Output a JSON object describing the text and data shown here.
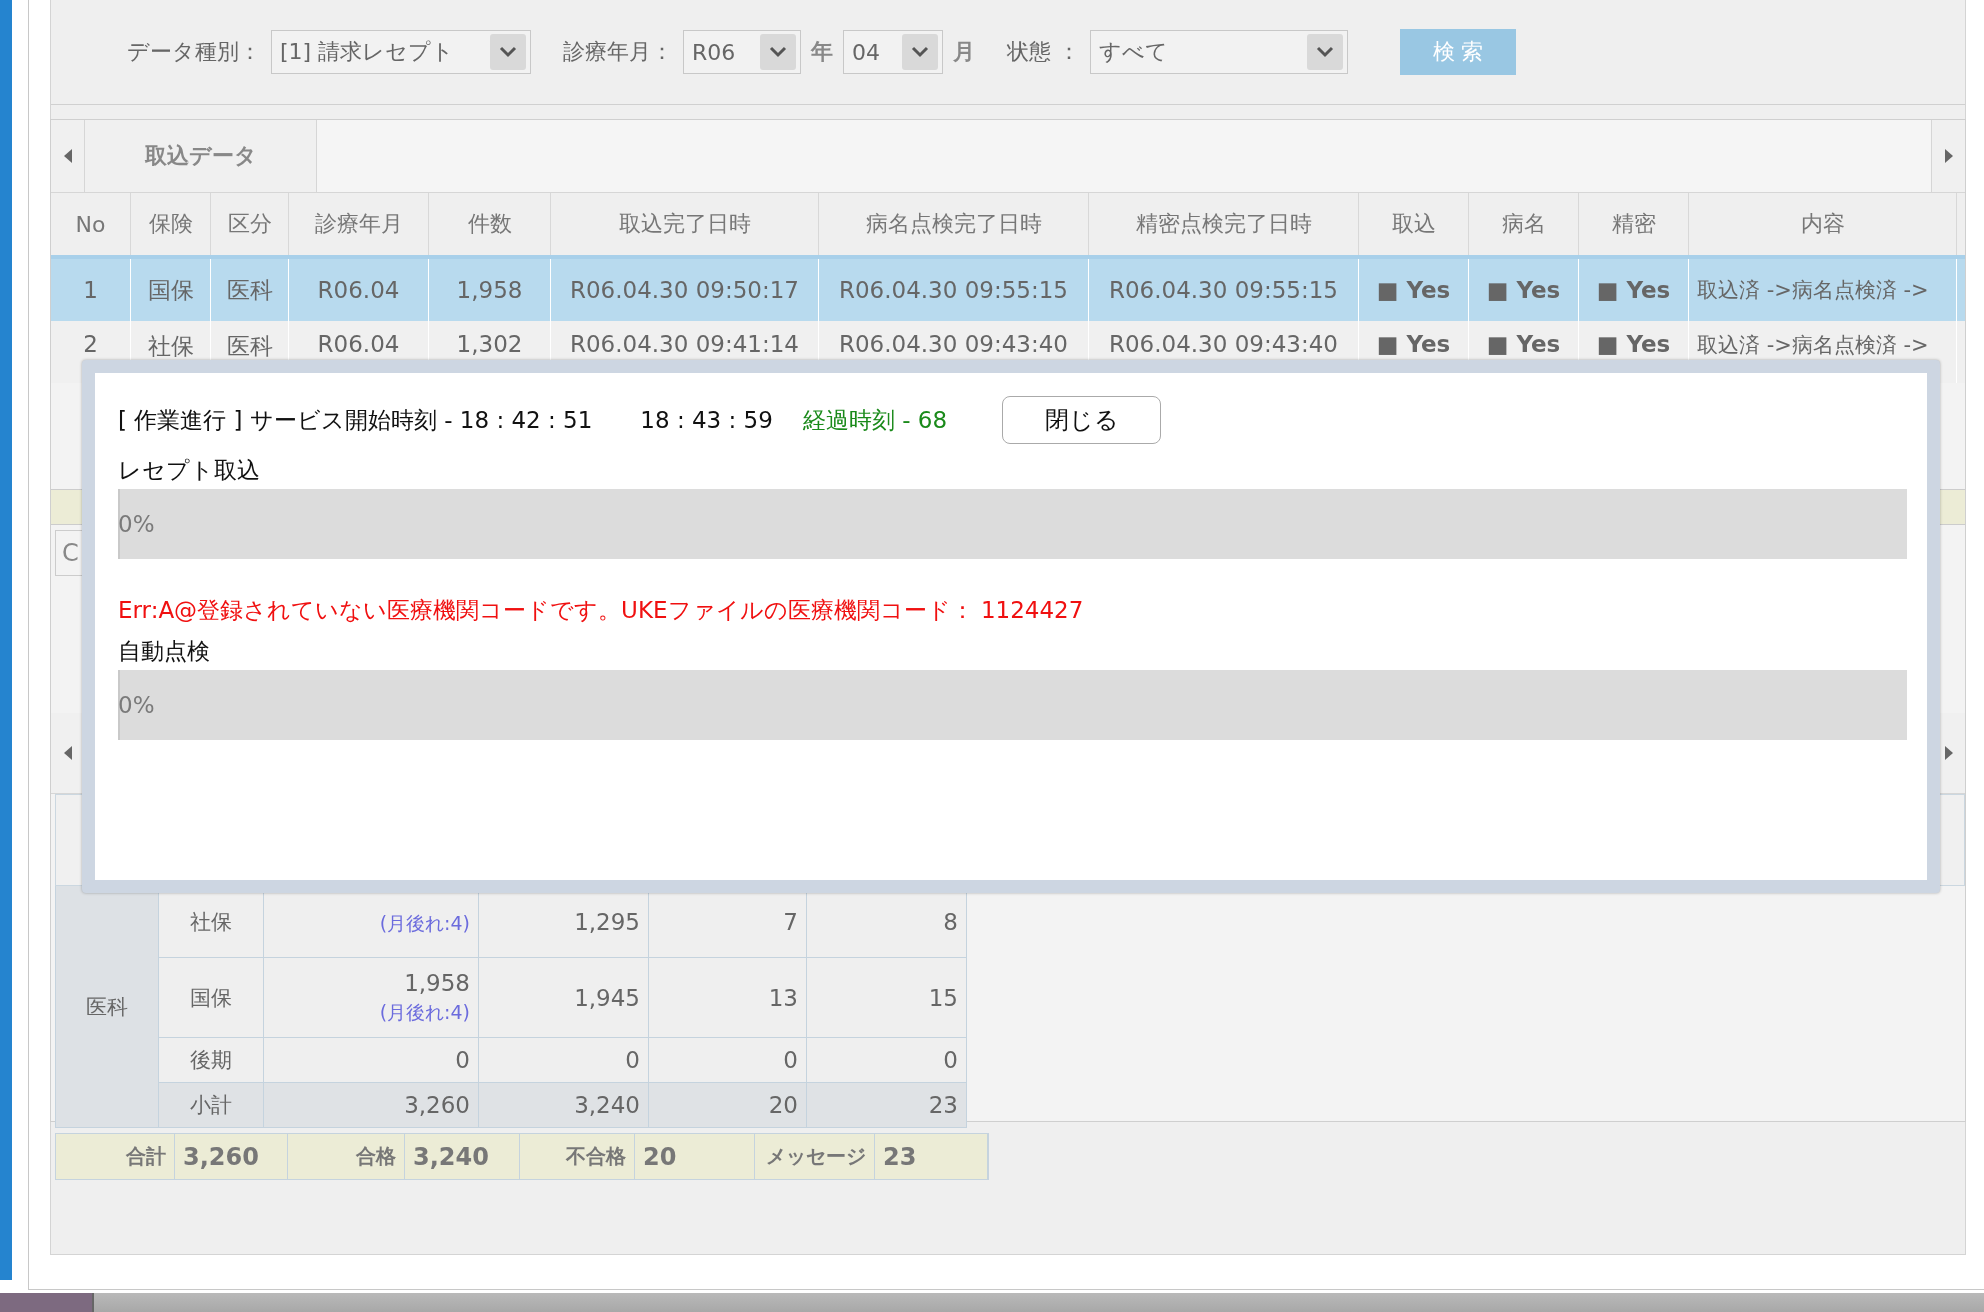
{
  "filter_bar": {
    "items": [
      {
        "kind": "label",
        "text": "データ種別："
      },
      {
        "kind": "select",
        "value": "[1] 請求レセプト"
      },
      {
        "kind": "label",
        "text": "診療年月："
      },
      {
        "kind": "select",
        "value": "R06"
      },
      {
        "kind": "unit",
        "text": "年"
      },
      {
        "kind": "select",
        "value": "04"
      },
      {
        "kind": "unit",
        "text": "月"
      },
      {
        "kind": "label",
        "text": "状態 ："
      },
      {
        "kind": "select",
        "value": "すべて"
      },
      {
        "kind": "button",
        "text": "検 索"
      }
    ]
  },
  "data_tabs": {
    "tabs": [
      {
        "label": "取込データ",
        "selected": true
      }
    ]
  },
  "table": {
    "columns": [
      "No",
      "保険",
      "区分",
      "診療年月",
      "件数",
      "取込完了日時",
      "病名点検完了日時",
      "精密点検完了日時",
      "取込",
      "病名",
      "精密",
      "内容"
    ],
    "rows": [
      {
        "selected": true,
        "cells": [
          "1",
          "国保",
          "医科",
          "R06.04",
          "1,958",
          "R06.04.30 09:50:17",
          "R06.04.30 09:55:15",
          "R06.04.30 09:55:15",
          "■ Yes",
          "■ Yes",
          "■ Yes",
          "取込済 ->病名点検済 ->"
        ]
      },
      {
        "selected": false,
        "cells": [
          "2",
          "社保",
          "医科",
          "R06.04",
          "1,302",
          "R06.04.30 09:41:14",
          "R06.04.30 09:43:40",
          "R06.04.30 09:43:40",
          "■ Yes",
          "■ Yes",
          "■ Yes",
          "取込済 ->病名点検済 ->"
        ]
      }
    ]
  },
  "hidden_button": {
    "label": "C"
  },
  "summary": {
    "group": "医科",
    "rows": [
      {
        "kind": "row",
        "label": "社保",
        "cells": [
          {
            "note": "(月後れ:4)"
          },
          {
            "value": "1,295"
          },
          {
            "value": "7"
          },
          {
            "value": "8"
          }
        ]
      },
      {
        "kind": "row",
        "label": "国保",
        "cells": [
          {
            "value": "1,958",
            "note": "(月後れ:4)"
          },
          {
            "value": "1,945"
          },
          {
            "value": "13"
          },
          {
            "value": "15"
          }
        ]
      },
      {
        "kind": "row",
        "label": "後期",
        "cells": [
          {
            "value": "0"
          },
          {
            "value": "0"
          },
          {
            "value": "0"
          },
          {
            "value": "0"
          }
        ]
      },
      {
        "kind": "subtotal",
        "label": "小計",
        "cells": [
          {
            "value": "3,260"
          },
          {
            "value": "3,240"
          },
          {
            "value": "20"
          },
          {
            "value": "23"
          }
        ]
      }
    ]
  },
  "totals": [
    {
      "label": "合計",
      "value": "3,260"
    },
    {
      "label": "合格",
      "value": "3,240"
    },
    {
      "label": "不合格",
      "value": "20"
    },
    {
      "label": "メッセージ",
      "value": "23"
    }
  ],
  "dialog": {
    "title": "[ 作業進行 ] サービス開始時刻 - 18 : 42 : 51",
    "current_time": "18 : 43 : 59",
    "elapsed": "経過時刻 - 68",
    "close_button": "閉じる",
    "sections": [
      {
        "label": "レセプト取込",
        "level": 0,
        "percent": "0%",
        "error": "Err:A@登録されていない医療機関コードです。UKEファイルの医療機関コード： 1124427"
      },
      {
        "label": "自動点検",
        "level": 0,
        "percent": "0%"
      }
    ]
  }
}
